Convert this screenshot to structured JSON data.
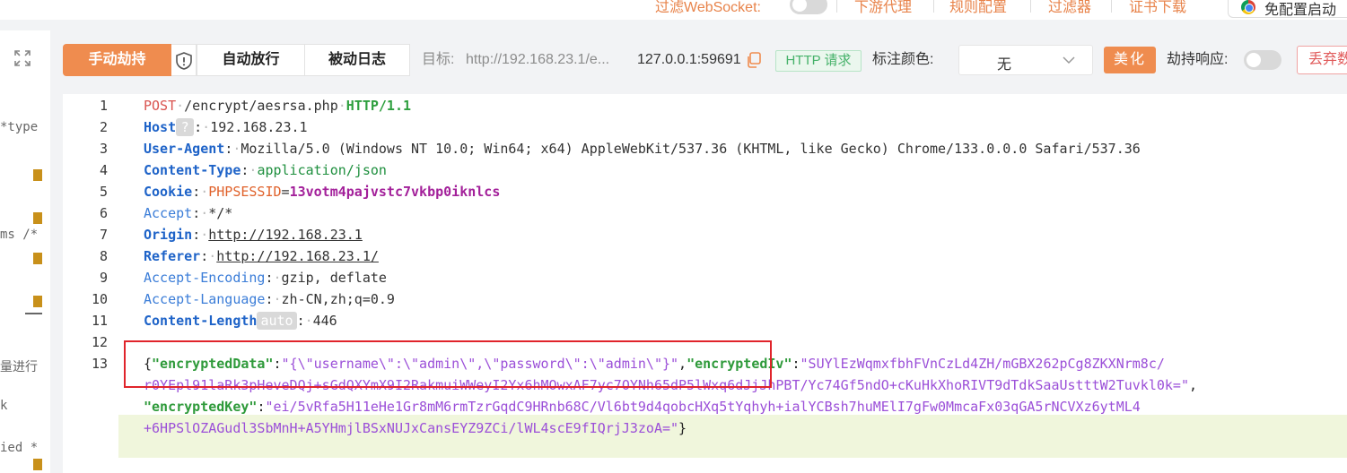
{
  "topbar": {
    "websocket_filter": "过滤WebSocket:",
    "downstream_proxy": "下游代理",
    "rule_config": "规则配置",
    "filter": "过滤器",
    "cert_download": "证书下载",
    "chrome_button": "免配置启动"
  },
  "left_panel": {
    "fragments": [
      "*type",
      "ms /*",
      "量进行",
      "ied *",
      "k"
    ]
  },
  "toolbar": {
    "hijack_button": "手动劫持",
    "auto_release": "自动放行",
    "passive_log": "被动日志",
    "target_label": "目标:",
    "target_value": "http://192.168.23.1/e...",
    "client_addr": "127.0.0.1:59691",
    "http_badge": "HTTP 请求",
    "tag_color_label": "标注颜色:",
    "tag_color_value": "无",
    "beautify_button": "美化",
    "hijack_response_label": "劫持响应:",
    "discard_button": "丢弃数据"
  },
  "editor": {
    "line_numbers": [
      "1",
      "2",
      "3",
      "4",
      "5",
      "6",
      "7",
      "8",
      "9",
      "10",
      "11",
      "12",
      "13"
    ],
    "line1": {
      "method": "POST",
      "path": "/encrypt/aesrsa.php",
      "version": "HTTP/1.1"
    },
    "line2": {
      "name": "Host",
      "badge": "?",
      "value": "192.168.23.1"
    },
    "line3": {
      "name": "User-Agent",
      "value": "Mozilla/5.0 (Windows NT 10.0; Win64; x64) AppleWebKit/537.36 (KHTML, like Gecko) Chrome/133.0.0.0 Safari/537.36"
    },
    "line4": {
      "name": "Content-Type",
      "value": "application/json"
    },
    "line5": {
      "name": "Cookie",
      "cookie_name": "PHPSESSID",
      "cookie_value": "13votm4pajvstc7vkbp0iknlcs"
    },
    "line6": {
      "name": "Accept",
      "value": "*/*"
    },
    "line7": {
      "name": "Origin",
      "value": "http://192.168.23.1"
    },
    "line8": {
      "name": "Referer",
      "value": "http://192.168.23.1/"
    },
    "line9": {
      "name": "Accept-Encoding",
      "value": "gzip, deflate"
    },
    "line10": {
      "name": "Accept-Language",
      "value": "zh-CN,zh;q=0.9"
    },
    "line11": {
      "name": "Content-Length",
      "badge": "auto",
      "value": "446"
    },
    "body": {
      "key1": "\"encryptedData\"",
      "val1": "\"{\\\"username\\\":\\\"admin\\\",\\\"password\\\":\\\"admin\\\"}\"",
      "key2": "\"encryptedIv\"",
      "val2a": "\"SUYlEzWqmxfbhFVnCzLd4ZH/mGBX262pCg8ZKXNrm8c/",
      "val2b": "r0YEpl91laRk3pHeveDQj+sGdQXYmX9I2RakmuiWWeyI2Yx6hMOwxAF7yc7OYNh65dP5lWxq6dJjJhPBT/Yc74Gf5ndO+cKuHkXhoRIVT9dTdkSaaUstttW2Tuvkl0k=\"",
      "key3": "\"encryptedKey\"",
      "val3a": "\"ei/5vRfa5H11eHe1Gr8mM6rmTzrGqdC9HRnb68C/Vl6bt9d4qobcHXq5tYqhyh+ialYCBsh7huMElI7gFw0MmcaFx03qGA5rNCVXz6ytML4",
      "val3b": "+6HPSlOZAGudl3SbMnH+A5YHmjlBSxNUJxCansEYZ9ZCi/lWL4scE9fIQrjJ3zoA=\""
    }
  },
  "colors": {
    "accent": "#ef8c4f",
    "highlight_box": "#e0242b",
    "json_key": "#2e9a3a",
    "json_string": "#9b4fd8"
  }
}
